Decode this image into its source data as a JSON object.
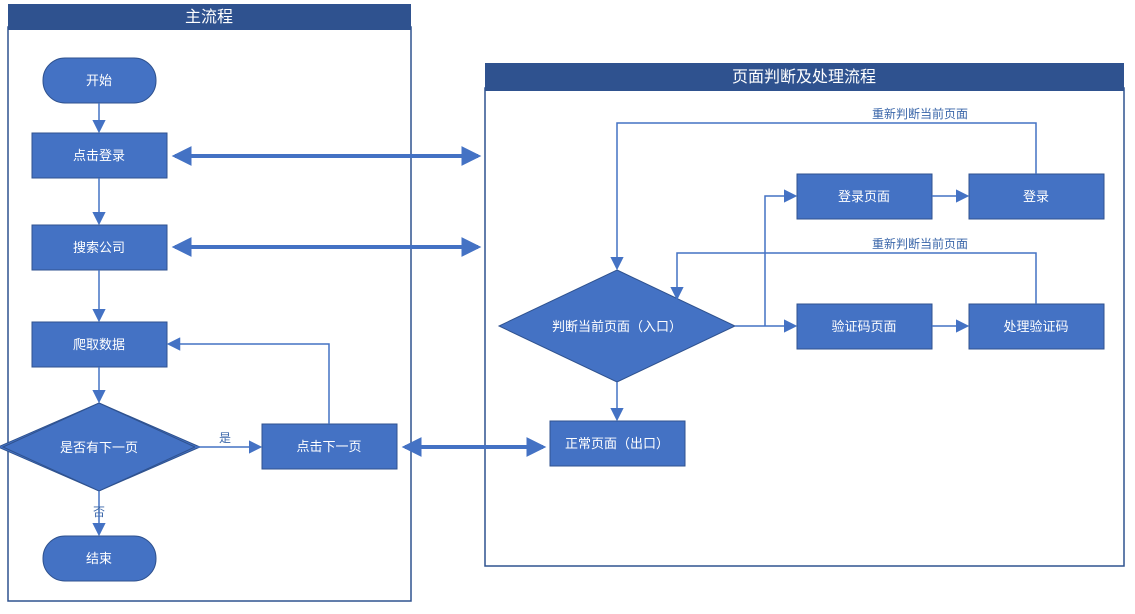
{
  "panels": {
    "main": {
      "title": "主流程"
    },
    "page": {
      "title": "页面判断及处理流程"
    }
  },
  "nodes": {
    "start": "开始",
    "click_login": "点击登录",
    "search_co": "搜索公司",
    "crawl": "爬取数据",
    "has_next": "是否有下一页",
    "click_next": "点击下一页",
    "end": "结束",
    "judge_entry": "判断当前页面（入口）",
    "normal_exit": "正常页面（出口）",
    "login_page": "登录页面",
    "do_login": "登录",
    "captcha_page": "验证码页面",
    "do_captcha": "处理验证码"
  },
  "edge_labels": {
    "yes": "是",
    "no": "否",
    "rejudge": "重新判断当前页面"
  }
}
